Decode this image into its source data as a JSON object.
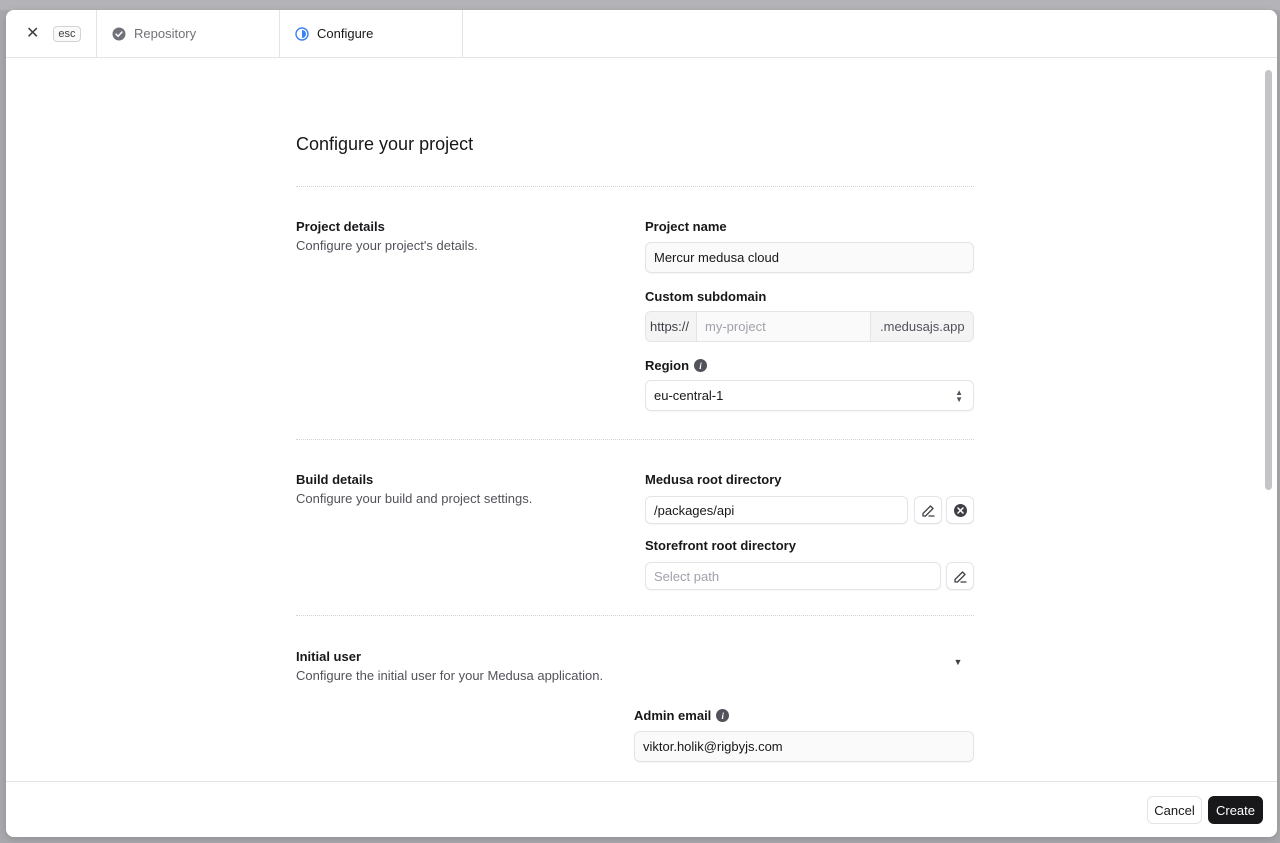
{
  "topbar": {
    "esc_label": "esc",
    "tabs": [
      {
        "label": "Repository",
        "state": "done"
      },
      {
        "label": "Configure",
        "state": "active"
      }
    ]
  },
  "page": {
    "title": "Configure your project"
  },
  "project_details": {
    "title": "Project details",
    "description": "Configure your project's details.",
    "project_name": {
      "label": "Project name",
      "value": "Mercur medusa cloud"
    },
    "subdomain": {
      "label": "Custom subdomain",
      "prefix": "https://",
      "placeholder": "my-project",
      "suffix": ".medusajs.app"
    },
    "region": {
      "label": "Region",
      "value": "eu-central-1"
    }
  },
  "build_details": {
    "title": "Build details",
    "description": "Configure your build and project settings.",
    "medusa_root": {
      "label": "Medusa root directory",
      "value": "/packages/api"
    },
    "storefront_root": {
      "label": "Storefront root directory",
      "placeholder": "Select path"
    }
  },
  "initial_user": {
    "title": "Initial user",
    "description": "Configure the initial user for your Medusa application.",
    "admin_email": {
      "label": "Admin email",
      "value": "viktor.holik@rigbyjs.com"
    }
  },
  "footer": {
    "cancel_label": "Cancel",
    "create_label": "Create"
  },
  "colors": {
    "primary_button": "#18181b",
    "backdrop": "#a9a9ad",
    "active_step_icon": "#3b82f6"
  }
}
